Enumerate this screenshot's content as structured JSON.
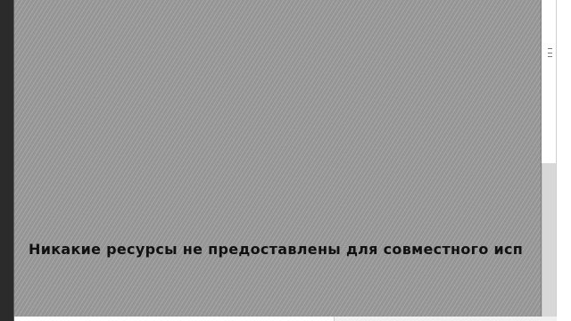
{
  "share_panel": {
    "message": "Никакие ресурсы не предоставлены для совместного исп"
  },
  "icons": {
    "grip": "grip-lines-icon"
  }
}
